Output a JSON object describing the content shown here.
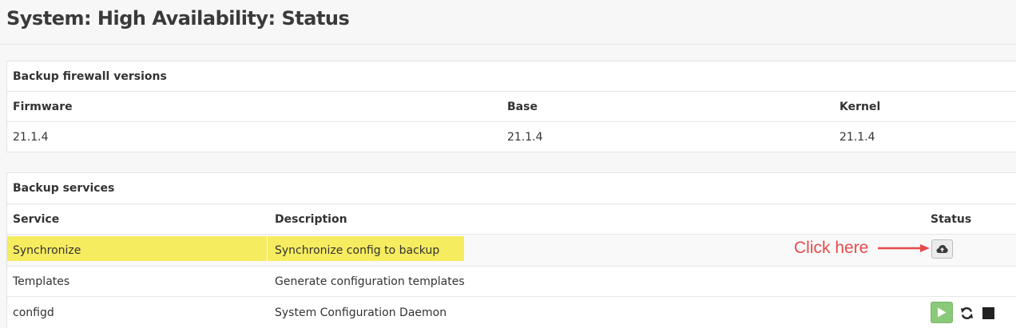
{
  "page": {
    "title": "System: High Availability: Status"
  },
  "versions_panel": {
    "title": "Backup firewall versions",
    "columns": [
      "Firmware",
      "Base",
      "Kernel"
    ],
    "values": [
      "21.1.4",
      "21.1.4",
      "21.1.4"
    ]
  },
  "services_panel": {
    "title": "Backup services",
    "columns": {
      "service": "Service",
      "description": "Description",
      "status": "Status"
    },
    "rows": [
      {
        "service": "Synchronize",
        "description": "Synchronize config to backup",
        "highlighted": true,
        "actions": [
          "cloud-upload-icon"
        ]
      },
      {
        "service": "Templates",
        "description": "Generate configuration templates",
        "highlighted": false,
        "actions": []
      },
      {
        "service": "configd",
        "description": "System Configuration Daemon",
        "highlighted": false,
        "actions": [
          "play-icon",
          "refresh-icon",
          "stop-icon"
        ]
      }
    ]
  },
  "annotation": {
    "text": "Click here",
    "color": "#e84a4a"
  },
  "colors": {
    "highlight": "#f6ec5f",
    "play_button": "#8bc97a",
    "annotation": "#e84a4a"
  }
}
